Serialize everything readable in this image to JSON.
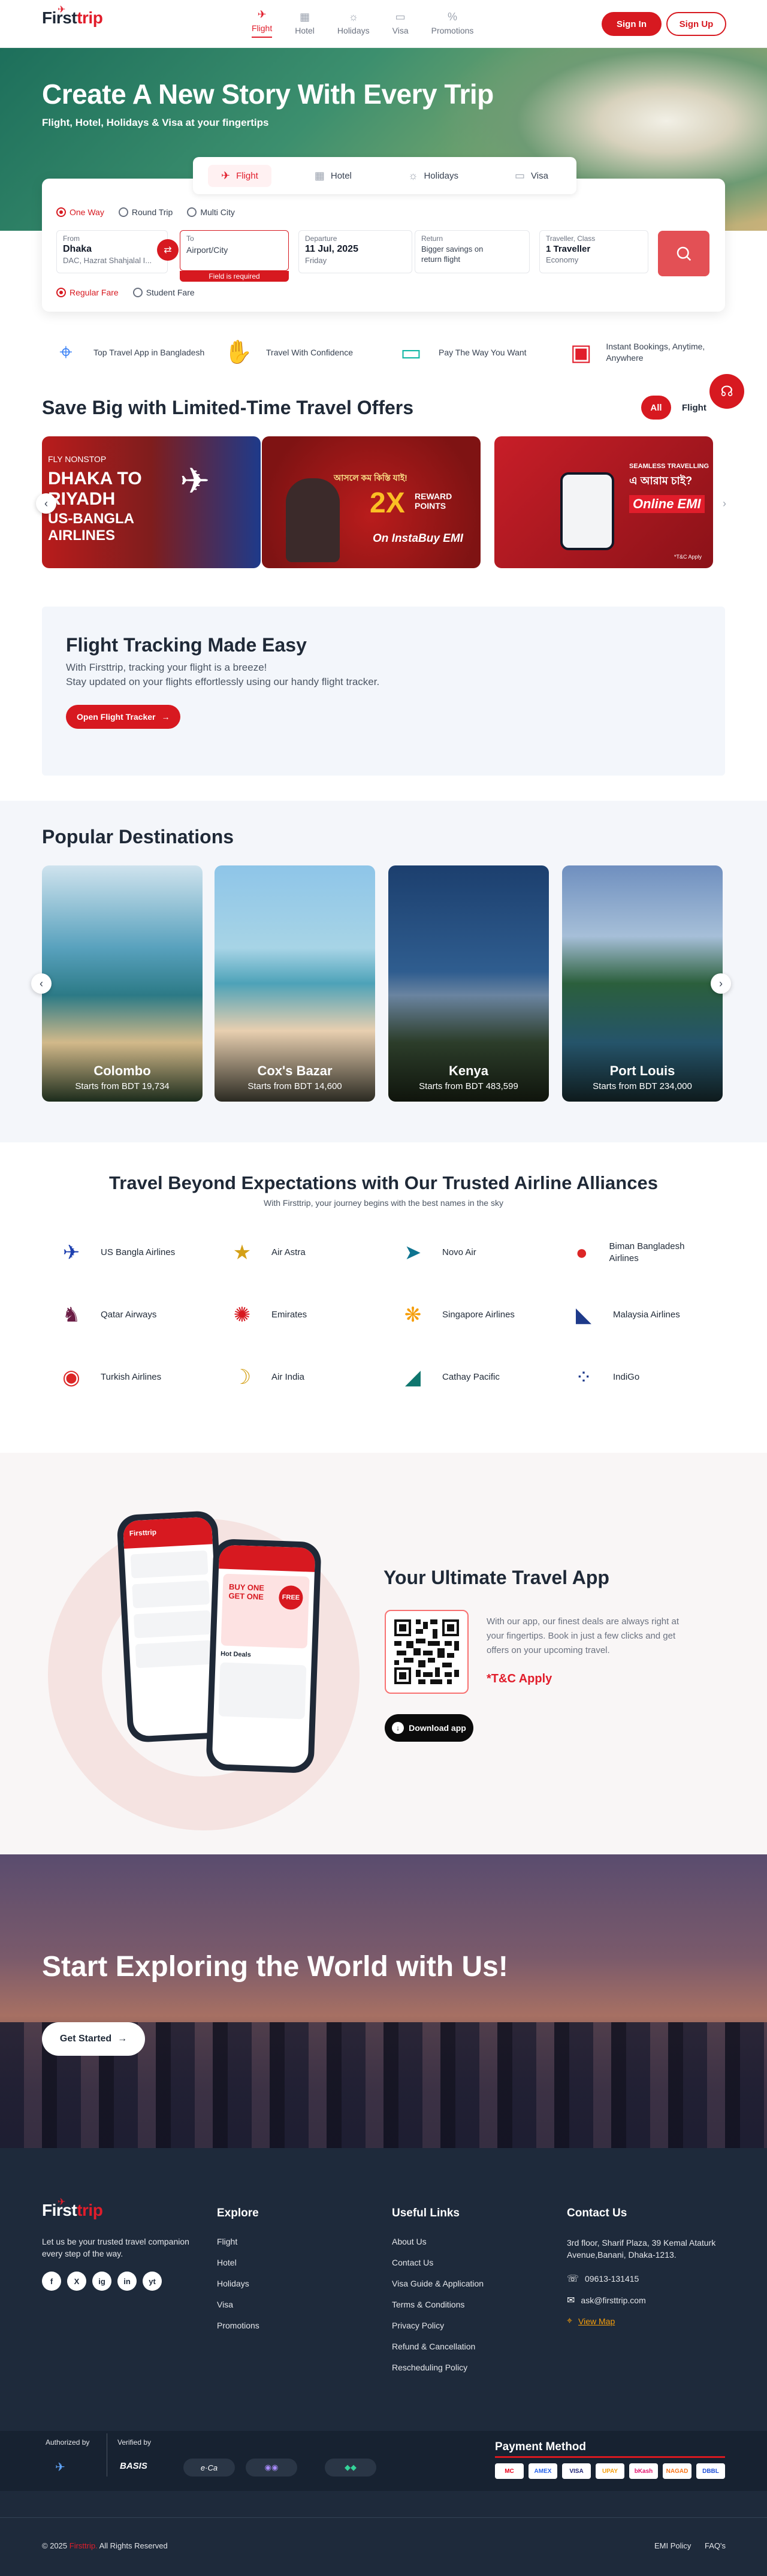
{
  "header": {
    "logo_main": "First",
    "logo_accent": "trip",
    "nav": [
      {
        "label": "Flight",
        "icon": "plane-icon"
      },
      {
        "label": "Hotel",
        "icon": "hotel-icon"
      },
      {
        "label": "Holidays",
        "icon": "palm-icon"
      },
      {
        "label": "Visa",
        "icon": "passport-icon"
      },
      {
        "label": "Promotions",
        "icon": "tag-icon"
      }
    ],
    "sign_in": "Sign In",
    "sign_up": "Sign Up"
  },
  "hero": {
    "title": "Create A New Story With Every Trip",
    "subtitle": "Flight, Hotel, Holidays & Visa at your fingertips"
  },
  "search": {
    "tabs": [
      {
        "label": "Flight"
      },
      {
        "label": "Hotel"
      },
      {
        "label": "Holidays"
      },
      {
        "label": "Visa"
      }
    ],
    "trip_types": [
      "One Way",
      "Round Trip",
      "Multi City"
    ],
    "from": {
      "label": "From",
      "city": "Dhaka",
      "detail": "DAC, Hazrat Shahjalal I..."
    },
    "to": {
      "label": "To",
      "placeholder": "Airport/City",
      "error": "Field is required"
    },
    "departure": {
      "label": "Departure",
      "date": "11 Jul, 2025",
      "day": "Friday"
    },
    "return": {
      "label": "Return",
      "text": "Bigger savings on return flight"
    },
    "traveller": {
      "label": "Traveller, Class",
      "count": "1 Traveller",
      "class": "Economy"
    },
    "fares": [
      "Regular Fare",
      "Student Fare"
    ]
  },
  "features": [
    "Top Travel App in Bangladesh",
    "Travel With Confidence",
    "Pay The Way You Want",
    "Instant Bookings, Anytime, Anywhere"
  ],
  "offers": {
    "title": "Save Big with Limited-Time Travel Offers",
    "filters": [
      "All",
      "Flight"
    ],
    "o1": {
      "tag": "FLY NONSTOP",
      "line1": "DHAKA TO",
      "line2": "RIYADH",
      "line3": "US-BANGLA",
      "line4": "AIRLINES"
    },
    "o2": {
      "line1": "আসলে কম কিস্তি যাই!",
      "big": "2X",
      "reward": "REWARD POINTS",
      "emi": "On InstaBuy EMI"
    },
    "o3": {
      "line1": "SEAMLESS TRAVELLING",
      "line2": "এ আরাম চাই?",
      "line3": "Online EMI",
      "tc": "*T&C Apply"
    }
  },
  "tracking": {
    "title": "Flight Tracking Made Easy",
    "line1": "With Firsttrip, tracking your flight is a breeze!",
    "line2": "Stay updated on your flights effortlessly using our handy flight tracker.",
    "button": "Open Flight Tracker"
  },
  "destinations": {
    "title": "Popular Destinations",
    "items": [
      {
        "name": "Colombo",
        "price": "Starts from BDT 19,734"
      },
      {
        "name": "Cox's Bazar",
        "price": "Starts from BDT 14,600"
      },
      {
        "name": "Kenya",
        "price": "Starts from BDT 483,599"
      },
      {
        "name": "Port Louis",
        "price": "Starts from BDT 234,000"
      }
    ]
  },
  "airlines": {
    "title": "Travel Beyond Expectations with Our Trusted Airline Alliances",
    "subtitle": "With Firsttrip, your journey begins with the best names in the sky",
    "items": [
      "US Bangla Airlines",
      "Air Astra",
      "Novo Air",
      "Biman Bangladesh Airlines",
      "Qatar Airways",
      "Emirates",
      "Singapore Airlines",
      "Malaysia Airlines",
      "Turkish Airlines",
      "Air India",
      "Cathay Pacific",
      "IndiGo"
    ]
  },
  "app": {
    "title": "Your Ultimate Travel App",
    "text": "With our app, our finest deals are always right at your fingertips. Book in just a few clicks and get offers on your upcoming travel.",
    "tc": "*T&C Apply",
    "download": "Download app",
    "phone_brand": "Firsttrip",
    "phone_tag": "BUY ONE GET ONE",
    "phone_free": "FREE",
    "phone_hot": "Hot Deals"
  },
  "explore": {
    "title": "Start Exploring the World with Us!",
    "button": "Get Started"
  },
  "footer": {
    "tagline": "Let us be your trusted travel companion every step of the way.",
    "social": [
      "f",
      "X",
      "ig",
      "in",
      "yt"
    ],
    "explore_title": "Explore",
    "explore": [
      "Flight",
      "Hotel",
      "Holidays",
      "Visa",
      "Promotions"
    ],
    "links_title": "Useful Links",
    "links": [
      "About Us",
      "Contact Us",
      "Visa Guide & Application",
      "Terms & Conditions",
      "Privacy Policy",
      "Refund & Cancellation",
      "Rescheduling Policy"
    ],
    "contact_title": "Contact Us",
    "address": "3rd floor, Sharif Plaza, 39 Kemal Ataturk Avenue,Banani, Dhaka-1213.",
    "phone": "09613-131415",
    "email": "ask@firsttrip.com",
    "map": "View Map",
    "authorized": "Authorized by",
    "verified": "Verified by",
    "basis": "BASIS",
    "payment_title": "Payment Method",
    "payments": [
      "MC",
      "AMEX",
      "VISA",
      "UPAY",
      "bKash",
      "NAGAD",
      "DBBL"
    ],
    "copyright_pre": "© 2025",
    "copyright_brand": "Firsttrip.",
    "copyright_post": "All Rights Reserved",
    "emi": "EMI Policy",
    "faq": "FAQ's"
  }
}
